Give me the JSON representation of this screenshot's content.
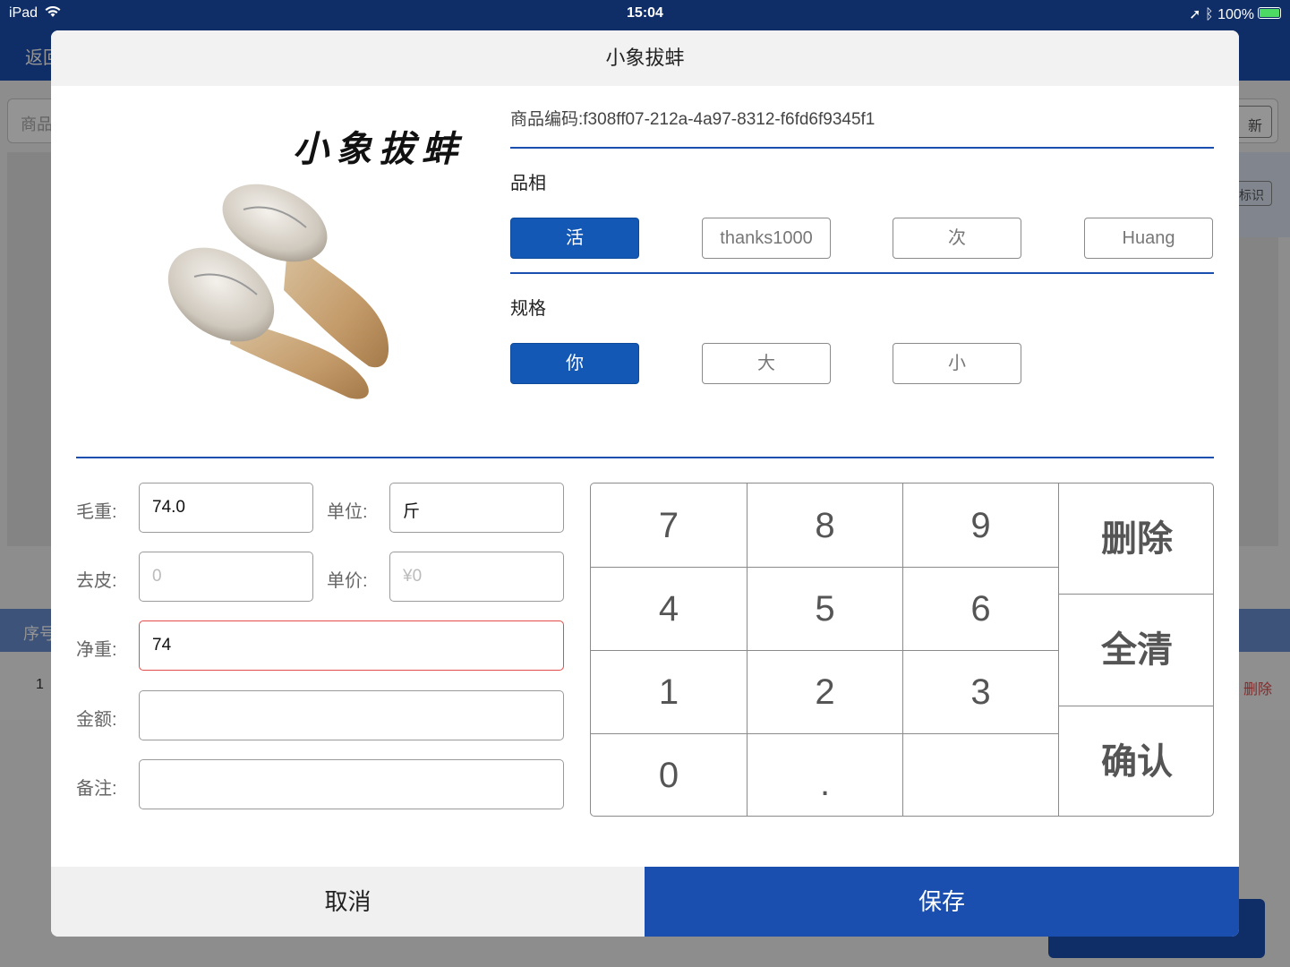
{
  "status_bar": {
    "device": "iPad",
    "time": "15:04",
    "battery": "100%"
  },
  "background": {
    "back_label": "返回",
    "search_placeholder": "商品",
    "refresh_label": "新",
    "tag_label": "标识",
    "table_header": "序号",
    "row_index": "1",
    "row_delete": "删除"
  },
  "dialog": {
    "title": "小象拔蚌",
    "image_caption": "小象拔蚌",
    "product_code": "商品编码:f308ff07-212a-4a97-8312-f6fd6f9345f1",
    "appearance": {
      "label": "品相",
      "options": [
        "活",
        "thanks1000",
        "次",
        "Huang"
      ],
      "selected": "活"
    },
    "spec": {
      "label": "规格",
      "options": [
        "你",
        "大",
        "小"
      ],
      "selected": "你"
    },
    "form": {
      "gross_weight_label": "毛重:",
      "gross_weight_value": "74.0",
      "unit_label": "单位:",
      "unit_value": "斤",
      "tare_label": "去皮:",
      "tare_placeholder": "0",
      "unit_price_label": "单价:",
      "unit_price_placeholder": "¥0",
      "net_weight_label": "净重:",
      "net_weight_value": "74",
      "amount_label": "金额:",
      "amount_value": "",
      "remark_label": "备注:",
      "remark_value": ""
    },
    "keypad": {
      "digits": [
        "7",
        "8",
        "9",
        "4",
        "5",
        "6",
        "1",
        "2",
        "3",
        "0",
        "."
      ],
      "delete_label": "删除",
      "clear_label": "全清",
      "confirm_label": "确认"
    },
    "cancel_label": "取消",
    "save_label": "保存"
  },
  "colors": {
    "primary": "#1a4fb0",
    "selected": "#1458b6",
    "error": "#e24b4b"
  }
}
